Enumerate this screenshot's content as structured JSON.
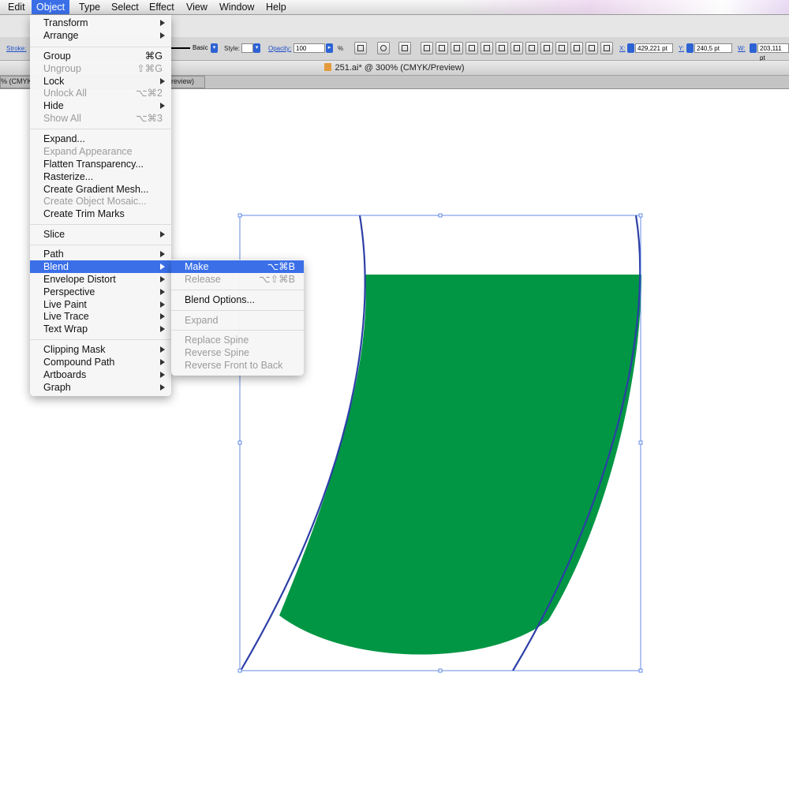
{
  "menubar": {
    "items": [
      "Edit",
      "Object",
      "Type",
      "Select",
      "Effect",
      "View",
      "Window",
      "Help"
    ],
    "active_item": "Object"
  },
  "control_bar": {
    "stroke_label": "Stroke:",
    "style_basic": "Basic",
    "style_label": "Style:",
    "opacity_label": "Opacity:",
    "opacity_value": "100",
    "opacity_unit": "%",
    "x_label": "X:",
    "x_value": "429,221 pt",
    "y_label": "Y:",
    "y_value": "240,5 pt",
    "w_label": "W:",
    "w_value": "203,111 pt"
  },
  "document": {
    "title": "251.ai* @ 300% (CMYK/Preview)",
    "tab_left": "% (CMYK",
    "tab_right": "review)"
  },
  "object_menu": {
    "items": [
      {
        "label": "Transform",
        "shortcut": "",
        "submenu": true,
        "enabled": true
      },
      {
        "label": "Arrange",
        "shortcut": "",
        "submenu": true,
        "enabled": true
      },
      {
        "label": "Group",
        "shortcut": "⌘G",
        "submenu": false,
        "enabled": true
      },
      {
        "label": "Ungroup",
        "shortcut": "⇧⌘G",
        "submenu": false,
        "enabled": false
      },
      {
        "label": "Lock",
        "shortcut": "",
        "submenu": true,
        "enabled": true
      },
      {
        "label": "Unlock All",
        "shortcut": "⌥⌘2",
        "submenu": false,
        "enabled": false
      },
      {
        "label": "Hide",
        "shortcut": "",
        "submenu": true,
        "enabled": true
      },
      {
        "label": "Show All",
        "shortcut": "⌥⌘3",
        "submenu": false,
        "enabled": false
      },
      {
        "label": "Expand...",
        "shortcut": "",
        "submenu": false,
        "enabled": true
      },
      {
        "label": "Expand Appearance",
        "shortcut": "",
        "submenu": false,
        "enabled": false
      },
      {
        "label": "Flatten Transparency...",
        "shortcut": "",
        "submenu": false,
        "enabled": true
      },
      {
        "label": "Rasterize...",
        "shortcut": "",
        "submenu": false,
        "enabled": true
      },
      {
        "label": "Create Gradient Mesh...",
        "shortcut": "",
        "submenu": false,
        "enabled": true
      },
      {
        "label": "Create Object Mosaic...",
        "shortcut": "",
        "submenu": false,
        "enabled": false
      },
      {
        "label": "Create Trim Marks",
        "shortcut": "",
        "submenu": false,
        "enabled": true
      },
      {
        "label": "Slice",
        "shortcut": "",
        "submenu": true,
        "enabled": true
      },
      {
        "label": "Path",
        "shortcut": "",
        "submenu": true,
        "enabled": true
      },
      {
        "label": "Blend",
        "shortcut": "",
        "submenu": true,
        "enabled": true,
        "highlighted": true
      },
      {
        "label": "Envelope Distort",
        "shortcut": "",
        "submenu": true,
        "enabled": true
      },
      {
        "label": "Perspective",
        "shortcut": "",
        "submenu": true,
        "enabled": true
      },
      {
        "label": "Live Paint",
        "shortcut": "",
        "submenu": true,
        "enabled": true
      },
      {
        "label": "Live Trace",
        "shortcut": "",
        "submenu": true,
        "enabled": true
      },
      {
        "label": "Text Wrap",
        "shortcut": "",
        "submenu": true,
        "enabled": true
      },
      {
        "label": "Clipping Mask",
        "shortcut": "",
        "submenu": true,
        "enabled": true
      },
      {
        "label": "Compound Path",
        "shortcut": "",
        "submenu": true,
        "enabled": true
      },
      {
        "label": "Artboards",
        "shortcut": "",
        "submenu": true,
        "enabled": true
      },
      {
        "label": "Graph",
        "shortcut": "",
        "submenu": true,
        "enabled": true
      }
    ]
  },
  "blend_submenu": {
    "items": [
      {
        "label": "Make",
        "shortcut": "⌥⌘B",
        "enabled": true,
        "highlighted": true
      },
      {
        "label": "Release",
        "shortcut": "⌥⇧⌘B",
        "enabled": false
      },
      {
        "label": "Blend Options...",
        "shortcut": "",
        "enabled": true
      },
      {
        "label": "Expand",
        "shortcut": "",
        "enabled": false
      },
      {
        "label": "Replace Spine",
        "shortcut": "",
        "enabled": false
      },
      {
        "label": "Reverse Spine",
        "shortcut": "",
        "enabled": false
      },
      {
        "label": "Reverse Front to Back",
        "shortcut": "",
        "enabled": false
      }
    ]
  },
  "colors": {
    "highlight": "#3a6fe8",
    "shape_fill": "#009644",
    "path_stroke": "#2d3fa6",
    "selection": "#3f6fe0"
  }
}
